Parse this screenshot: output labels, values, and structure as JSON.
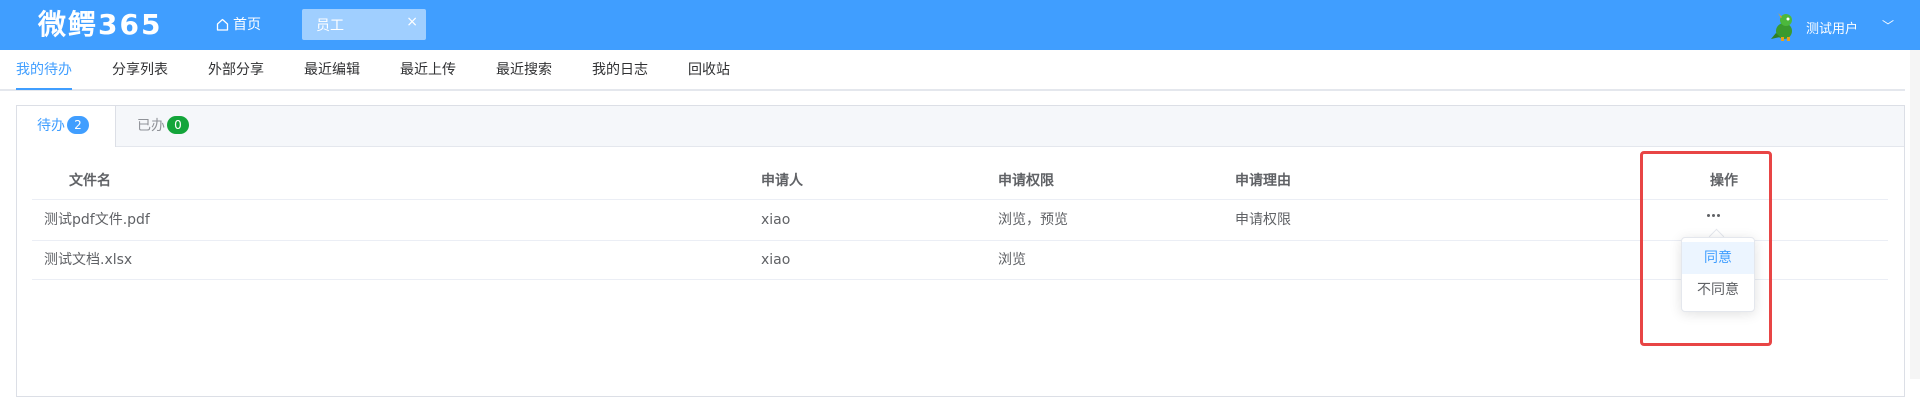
{
  "header": {
    "logo": "微鳄365",
    "home_label": "首页",
    "open_tab": {
      "label": "员工",
      "close": "×"
    },
    "user": {
      "name": "测试用户",
      "caret": "﹀"
    },
    "brand_color": "#409eff"
  },
  "subnav": {
    "items": [
      {
        "label": "我的待办",
        "active": true
      },
      {
        "label": "分享列表"
      },
      {
        "label": "外部分享"
      },
      {
        "label": "最近编辑"
      },
      {
        "label": "最近上传"
      },
      {
        "label": "最近搜索"
      },
      {
        "label": "我的日志"
      },
      {
        "label": "回收站"
      }
    ]
  },
  "card_tabs": [
    {
      "label": "待办",
      "badge": "2",
      "badge_color": "#409eff",
      "active": true
    },
    {
      "label": "已办",
      "badge": "0",
      "badge_color": "#13a53a",
      "active": false
    }
  ],
  "table": {
    "columns": [
      "文件名",
      "申请人",
      "申请权限",
      "申请理由",
      "操作"
    ],
    "rows": [
      {
        "file": "测试pdf文件.pdf",
        "applicant": "xiao",
        "permission": "浏览，预览",
        "reason": "申请权限"
      },
      {
        "file": "测试文档.xlsx",
        "applicant": "xiao",
        "permission": "浏览",
        "reason": ""
      }
    ]
  },
  "action_menu": {
    "items": [
      "同意",
      "不同意"
    ],
    "hovered": "同意"
  },
  "highlight_color": "#e84545"
}
